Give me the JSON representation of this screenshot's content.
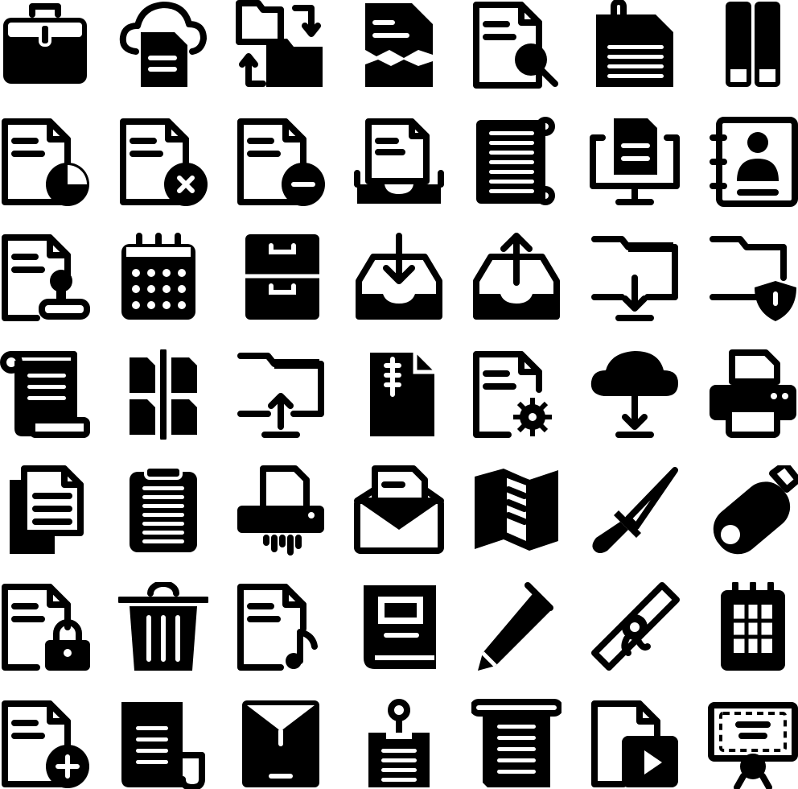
{
  "colors": {
    "foreground": "#000000",
    "background": "#ffffff"
  },
  "icons": [
    "briefcase-icon",
    "cloud-document-icon",
    "folder-transfer-icon",
    "torn-document-icon",
    "document-search-icon",
    "clipped-document-icon",
    "binders-icon",
    "document-pie-chart-icon",
    "document-delete-icon",
    "document-minus-icon",
    "document-tray-icon",
    "scroll-list-icon",
    "monitor-document-icon",
    "contact-book-icon",
    "document-stamp-icon",
    "calendar-icon",
    "filing-cabinet-icon",
    "inbox-download-icon",
    "inbox-upload-icon",
    "folder-download-icon",
    "folder-shield-icon",
    "scroll-icon",
    "split-documents-icon",
    "folder-upload-icon",
    "zipped-file-icon",
    "document-settings-icon",
    "cloud-download-icon",
    "printer-icon",
    "copy-documents-icon",
    "clipboard-icon",
    "paper-shredder-icon",
    "mail-document-icon",
    "folded-map-icon",
    "letter-opener-icon",
    "usb-drive-icon",
    "document-lock-icon",
    "trash-bin-icon",
    "document-music-icon",
    "book-icon",
    "pen-icon",
    "ruler-seal-icon",
    "grid-notebook-icon",
    "document-add-icon",
    "receipt-icon",
    "envelope-icon",
    "pinned-note-icon",
    "paper-scroll-icon",
    "video-file-icon",
    "certificate-icon"
  ]
}
